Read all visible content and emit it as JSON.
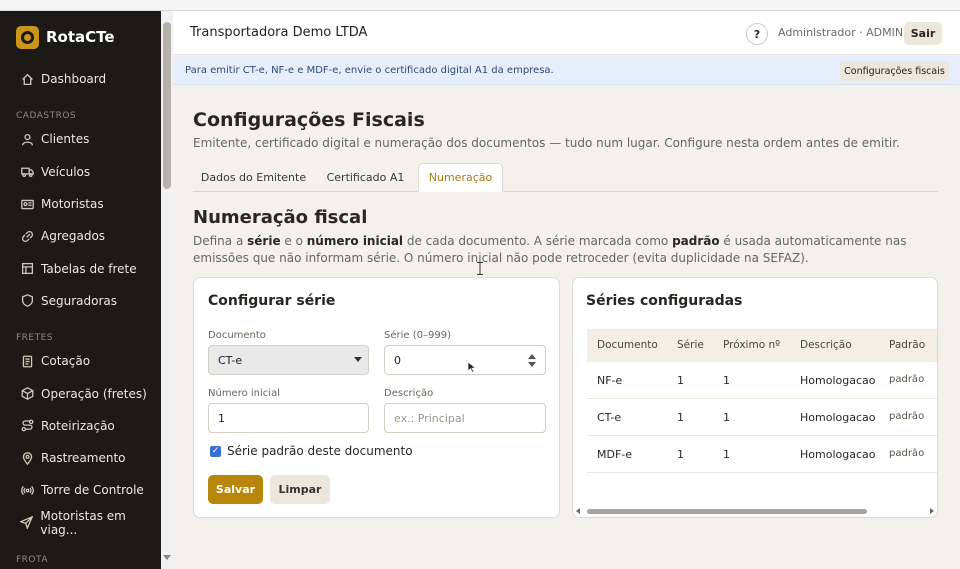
{
  "app": {
    "name": "RotaCTe"
  },
  "sidebar": {
    "top_items": [
      {
        "label": "Dashboard",
        "icon": "home-icon"
      }
    ],
    "sections": [
      {
        "title": "CADASTROS",
        "items": [
          {
            "label": "Clientes",
            "icon": "user-icon"
          },
          {
            "label": "Veículos",
            "icon": "truck-icon"
          },
          {
            "label": "Motoristas",
            "icon": "id-card-icon"
          },
          {
            "label": "Agregados",
            "icon": "link-icon"
          },
          {
            "label": "Tabelas de frete",
            "icon": "table-icon"
          },
          {
            "label": "Seguradoras",
            "icon": "shield-icon"
          }
        ]
      },
      {
        "title": "FRETES",
        "items": [
          {
            "label": "Cotação",
            "icon": "document-icon"
          },
          {
            "label": "Operação (fretes)",
            "icon": "box-icon"
          },
          {
            "label": "Roteirização",
            "icon": "route-icon"
          },
          {
            "label": "Rastreamento",
            "icon": "map-pin-icon"
          },
          {
            "label": "Torre de Controle",
            "icon": "radio-icon"
          },
          {
            "label": "Motoristas em viag...",
            "icon": "send-icon"
          }
        ]
      },
      {
        "title": "FROTA",
        "items": []
      }
    ]
  },
  "header": {
    "company": "Transportadora Demo LTDA",
    "help": "?",
    "user": "Administrador · ADMIN",
    "logout": "Sair"
  },
  "banner": {
    "text": "Para emitir CT-e, NF-e e MDF-e, envie o certificado digital A1 da empresa.",
    "button": "Configurações fiscais"
  },
  "page": {
    "title": "Configurações Fiscais",
    "subtitle": "Emitente, certificado digital e numeração dos documentos — tudo num lugar. Configure nesta ordem antes de emitir.",
    "tabs": [
      {
        "label": "Dados do Emitente",
        "active": false
      },
      {
        "label": "Certificado A1",
        "active": false
      },
      {
        "label": "Numeração",
        "active": true
      }
    ]
  },
  "numeracao": {
    "title": "Numeração fiscal",
    "desc_parts": {
      "p1": "Defina a ",
      "b1": "série",
      "p2": " e o ",
      "b2": "número inicial",
      "p3": " de cada documento. A série marcada como ",
      "b3": "padrão",
      "p4": " é usada automaticamente nas emissões que não informam série. O número inicial não pode retroceder (evita duplicidade na SEFAZ)."
    }
  },
  "form": {
    "title": "Configurar série",
    "documento_label": "Documento",
    "documento_value": "CT-e",
    "serie_label": "Série (0–999)",
    "serie_value": "0",
    "numero_label": "Número inicial",
    "numero_value": "1",
    "descricao_label": "Descrição",
    "descricao_placeholder": "ex.: Principal",
    "padrao_label": "Série padrão deste documento",
    "padrao_checked": true,
    "save": "Salvar",
    "clear": "Limpar"
  },
  "series": {
    "title": "Séries configuradas",
    "columns": [
      "Documento",
      "Série",
      "Próximo nº",
      "Descrição",
      "Padrão"
    ],
    "rows": [
      {
        "documento": "NF-e",
        "serie": "1",
        "proximo": "1",
        "descricao": "Homologacao",
        "padrao": "padrão"
      },
      {
        "documento": "CT-e",
        "serie": "1",
        "proximo": "1",
        "descricao": "Homologacao",
        "padrao": "padrão"
      },
      {
        "documento": "MDF-e",
        "serie": "1",
        "proximo": "1",
        "descricao": "Homologacao",
        "padrao": "padrão"
      }
    ]
  },
  "colors": {
    "accent": "#b8860b",
    "sidebar_bg": "#1c1a17",
    "banner_bg": "#e6eefb"
  }
}
